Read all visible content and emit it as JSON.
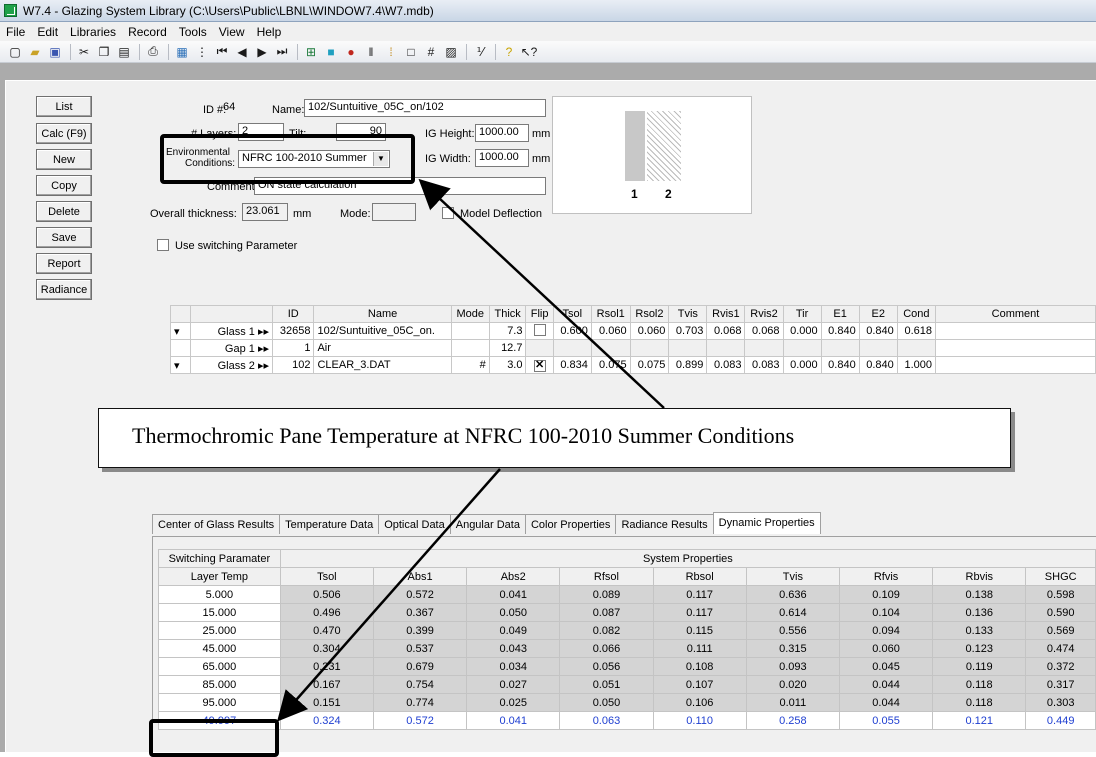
{
  "window": {
    "title": "W7.4 - Glazing System Library (C:\\Users\\Public\\LBNL\\WINDOW7.4\\W7.mdb)"
  },
  "menu": [
    "File",
    "Edit",
    "Libraries",
    "Record",
    "Tools",
    "View",
    "Help"
  ],
  "toolbar_icons": [
    "new-icon",
    "open-icon",
    "save-icon",
    "cut-icon",
    "copy-icon",
    "paste-icon",
    "print-icon",
    "list-icon",
    "detail-icon",
    "first-record-icon",
    "prev-record-icon",
    "next-record-icon",
    "last-record-icon",
    "grid-icon",
    "color-icon",
    "pin-icon",
    "bars-icon",
    "sort-icon",
    "square-icon",
    "hash-icon",
    "hatch-icon",
    "fraction-icon",
    "help-icon",
    "context-help-icon"
  ],
  "side_buttons": [
    "List",
    "Calc (F9)",
    "New",
    "Copy",
    "Delete",
    "Save",
    "Report",
    "Radiance"
  ],
  "form": {
    "id_label": "ID #:",
    "id_value": "64",
    "name_label": "Name:",
    "name_value": "102/Suntuitive_05C_on/102",
    "layers_label": "# Layers:",
    "layers_value": "2",
    "tilt_label": "Tilt:",
    "tilt_value": "90",
    "env_label_1": "Environmental",
    "env_label_2": "Conditions:",
    "env_value": "NFRC 100-2010 Summer",
    "ig_height_label": "IG Height:",
    "ig_height_value": "1000.00",
    "ig_height_unit": "mm",
    "ig_width_label": "IG Width:",
    "ig_width_value": "1000.00",
    "ig_width_unit": "mm",
    "comment_label": "Comment:",
    "comment_value": "ON state calculation",
    "thickness_label": "Overall thickness:",
    "thickness_value": "23.061",
    "thickness_unit": "mm",
    "mode_label": "Mode:",
    "model_deflection_label": "Model Deflection",
    "use_switching_label": "Use switching Parameter",
    "preview_labels": [
      "1",
      "2"
    ]
  },
  "layers": {
    "headers": [
      "ID",
      "Name",
      "Mode",
      "Thick",
      "Flip",
      "Tsol",
      "Rsol1",
      "Rsol2",
      "Tvis",
      "Rvis1",
      "Rvis2",
      "Tir",
      "E1",
      "E2",
      "Cond",
      "Comment"
    ],
    "rows": [
      {
        "label": "Glass 1",
        "id": "32658",
        "name": "102/Suntuitive_05C_on.",
        "mode": "",
        "thick": "7.3",
        "flip": false,
        "tsol": "0.600",
        "rsol1": "0.060",
        "rsol2": "0.060",
        "tvis": "0.703",
        "rvis1": "0.068",
        "rvis2": "0.068",
        "tir": "0.000",
        "e1": "0.840",
        "e2": "0.840",
        "cond": "0.618"
      },
      {
        "label": "Gap 1",
        "id": "1",
        "name": "Air",
        "mode": "",
        "thick": "12.7"
      },
      {
        "label": "Glass 2",
        "id": "102",
        "name": "CLEAR_3.DAT",
        "mode": "#",
        "thick": "3.0",
        "flip": true,
        "tsol": "0.834",
        "rsol1": "0.075",
        "rsol2": "0.075",
        "tvis": "0.899",
        "rvis1": "0.083",
        "rvis2": "0.083",
        "tir": "0.000",
        "e1": "0.840",
        "e2": "0.840",
        "cond": "1.000"
      }
    ]
  },
  "callout": "Thermochromic Pane Temperature at NFRC 100-2010 Summer Conditions",
  "tabs": [
    "Center of Glass Results",
    "Temperature Data",
    "Optical Data",
    "Angular Data",
    "Color Properties",
    "Radiance Results",
    "Dynamic Properties"
  ],
  "active_tab": "Dynamic Properties",
  "dynamic": {
    "switching_header": "Switching Paramater",
    "system_header": "System Properties",
    "columns": [
      "Layer Temp",
      "Tsol",
      "Abs1",
      "Abs2",
      "Rfsol",
      "Rbsol",
      "Tvis",
      "Rfvis",
      "Rbvis",
      "SHGC"
    ],
    "rows": [
      [
        "5.000",
        "0.506",
        "0.572",
        "0.041",
        "0.089",
        "0.117",
        "0.636",
        "0.109",
        "0.138",
        "0.598"
      ],
      [
        "15.000",
        "0.496",
        "0.367",
        "0.050",
        "0.087",
        "0.117",
        "0.614",
        "0.104",
        "0.136",
        "0.590"
      ],
      [
        "25.000",
        "0.470",
        "0.399",
        "0.049",
        "0.082",
        "0.115",
        "0.556",
        "0.094",
        "0.133",
        "0.569"
      ],
      [
        "45.000",
        "0.304",
        "0.537",
        "0.043",
        "0.066",
        "0.111",
        "0.315",
        "0.060",
        "0.123",
        "0.474"
      ],
      [
        "65.000",
        "0.231",
        "0.679",
        "0.034",
        "0.056",
        "0.108",
        "0.093",
        "0.045",
        "0.119",
        "0.372"
      ],
      [
        "85.000",
        "0.167",
        "0.754",
        "0.027",
        "0.051",
        "0.107",
        "0.020",
        "0.044",
        "0.118",
        "0.317"
      ],
      [
        "95.000",
        "0.151",
        "0.774",
        "0.025",
        "0.050",
        "0.106",
        "0.011",
        "0.044",
        "0.118",
        "0.303"
      ],
      [
        "49.997",
        "0.324",
        "0.572",
        "0.041",
        "0.063",
        "0.110",
        "0.258",
        "0.055",
        "0.121",
        "0.449"
      ]
    ]
  }
}
